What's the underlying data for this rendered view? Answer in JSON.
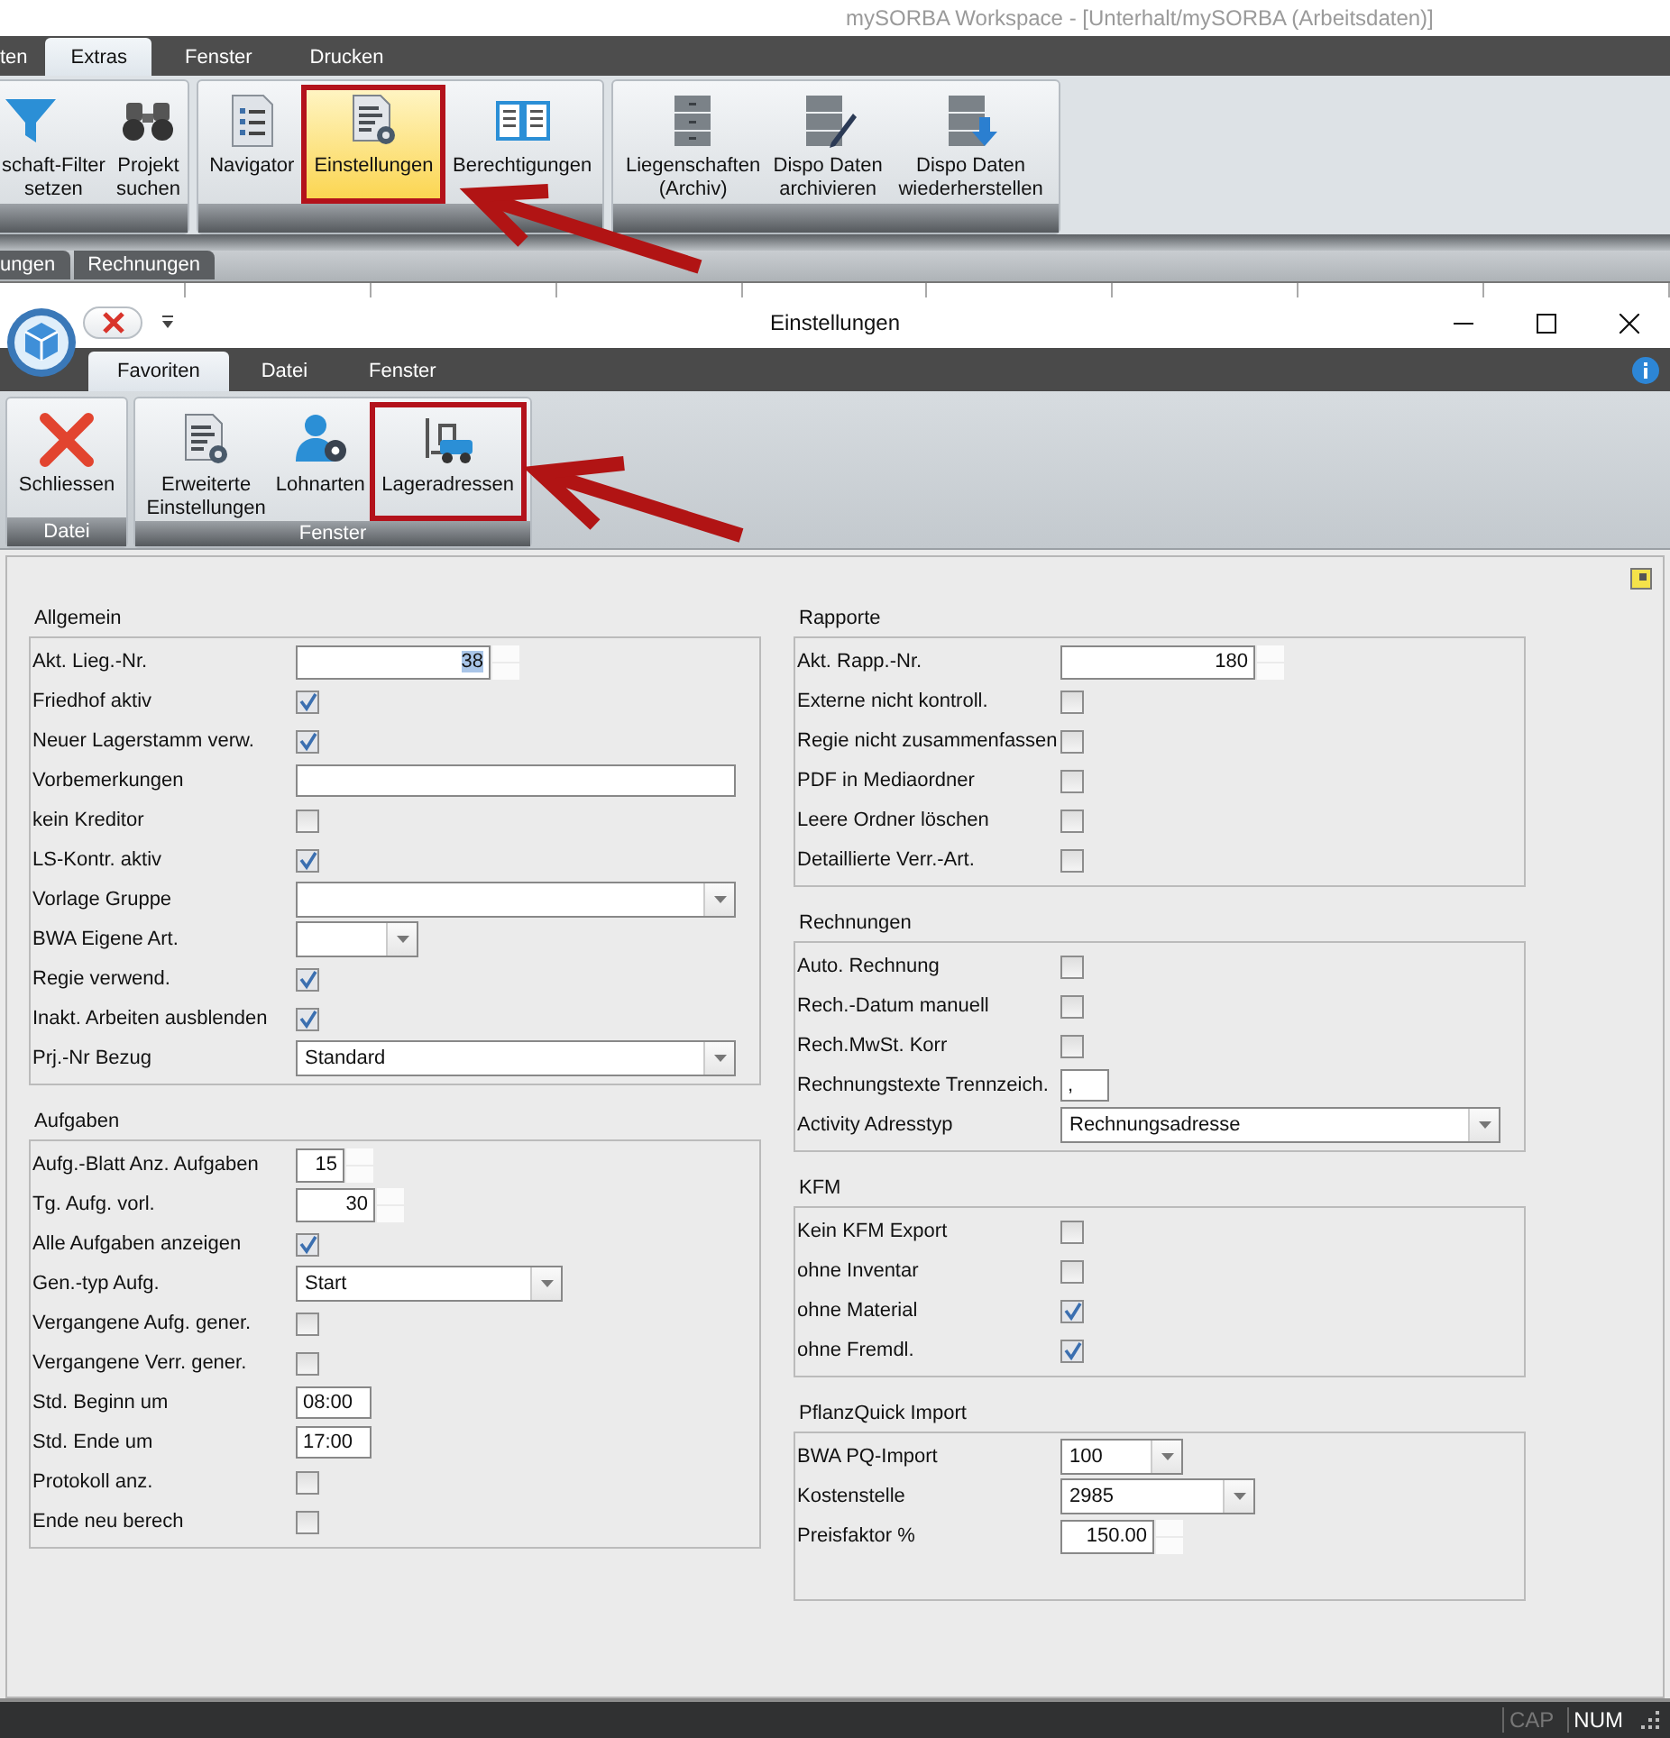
{
  "app": {
    "title": "mySORBA Workspace - [Unterhalt/mySORBA (Arbeitsdaten)]",
    "tabs": [
      {
        "label": "ten",
        "selected": false
      },
      {
        "label": "Extras",
        "selected": true
      },
      {
        "label": "Fenster",
        "selected": false
      },
      {
        "label": "Drucken",
        "selected": false
      }
    ],
    "ribbon_groups": [
      {
        "buttons": [
          {
            "label": "schaft-Filter\nsetzen",
            "selected": false,
            "highlighted": false
          },
          {
            "label": "Projekt\nsuchen",
            "selected": false,
            "highlighted": false
          }
        ]
      },
      {
        "buttons": [
          {
            "label": "Navigator",
            "selected": false,
            "highlighted": false
          },
          {
            "label": "Einstellungen",
            "selected": true,
            "highlighted": true
          },
          {
            "label": "Berechtigungen",
            "selected": false,
            "highlighted": false
          }
        ]
      },
      {
        "buttons": [
          {
            "label": "Liegenschaften\n(Archiv)",
            "selected": false,
            "highlighted": false
          },
          {
            "label": "Dispo Daten\narchivieren",
            "selected": false,
            "highlighted": false
          },
          {
            "label": "Dispo Daten\nwiederherstellen",
            "selected": false,
            "highlighted": false
          }
        ]
      }
    ],
    "document_tabs": [
      {
        "label": "ungen"
      },
      {
        "label": "Rechnungen"
      }
    ]
  },
  "dialog": {
    "title": "Einstellungen",
    "tabs": [
      {
        "label": "Favoriten",
        "selected": true
      },
      {
        "label": "Datei",
        "selected": false
      },
      {
        "label": "Fenster",
        "selected": false
      }
    ],
    "ribbon_groups": [
      {
        "label": "Datei",
        "buttons": [
          {
            "label": "Schliessen",
            "highlighted": false
          }
        ]
      },
      {
        "label": "Fenster",
        "buttons": [
          {
            "label": "Erweiterte\nEinstellungen",
            "highlighted": false
          },
          {
            "label": "Lohnarten",
            "highlighted": false
          },
          {
            "label": "Lageradressen",
            "highlighted": true
          }
        ]
      }
    ],
    "columns": [
      {
        "sections": [
          {
            "title": "Allgemein",
            "rows": [
              {
                "label": "Akt. Lieg.-Nr.",
                "kind": "spin",
                "value": "38",
                "text_selected": true
              },
              {
                "label": "Friedhof aktiv",
                "kind": "checkbox",
                "checked": true
              },
              {
                "label": "Neuer Lagerstamm verw.",
                "kind": "checkbox",
                "checked": true
              },
              {
                "label": "Vorbemerkungen",
                "kind": "text"
              },
              {
                "label": "kein Kreditor",
                "kind": "checkbox",
                "checked": false
              },
              {
                "label": "LS-Kontr. aktiv",
                "kind": "checkbox",
                "checked": true
              },
              {
                "label": "Vorlage Gruppe",
                "kind": "combo"
              },
              {
                "label": "BWA Eigene Art.",
                "kind": "combo"
              },
              {
                "label": "Regie verwend.",
                "kind": "checkbox",
                "checked": true
              },
              {
                "label": "Inakt. Arbeiten ausblenden",
                "kind": "checkbox",
                "checked": true
              },
              {
                "label": "Prj.-Nr Bezug",
                "kind": "combo",
                "value": "Standard"
              }
            ]
          },
          {
            "title": "Aufgaben",
            "rows": [
              {
                "label": "Aufg.-Blatt Anz. Aufgaben",
                "kind": "spin",
                "value": "15"
              },
              {
                "label": "Tg. Aufg. vorl.",
                "kind": "spin",
                "value": "30"
              },
              {
                "label": "Alle Aufgaben anzeigen",
                "kind": "checkbox",
                "checked": true
              },
              {
                "label": "Gen.-typ Aufg.",
                "kind": "combo",
                "value": "Start"
              },
              {
                "label": "Vergangene Aufg. gener.",
                "kind": "checkbox",
                "checked": false
              },
              {
                "label": "Vergangene Verr. gener.",
                "kind": "checkbox",
                "checked": false
              },
              {
                "label": "Std. Beginn um",
                "kind": "text",
                "value": "08:00"
              },
              {
                "label": "Std. Ende um",
                "kind": "text",
                "value": "17:00"
              },
              {
                "label": "Protokoll anz.",
                "kind": "checkbox",
                "checked": false
              },
              {
                "label": "Ende neu berech",
                "kind": "checkbox",
                "checked": false
              }
            ]
          }
        ]
      },
      {
        "sections": [
          {
            "title": "Rapporte",
            "rows": [
              {
                "label": "Akt. Rapp.-Nr.",
                "kind": "spin",
                "value": "180"
              },
              {
                "label": "Externe nicht kontroll.",
                "kind": "checkbox",
                "checked": false
              },
              {
                "label": "Regie nicht zusammenfassen",
                "kind": "checkbox",
                "checked": false
              },
              {
                "label": "PDF in Mediaordner",
                "kind": "checkbox",
                "checked": false
              },
              {
                "label": "Leere Ordner löschen",
                "kind": "checkbox",
                "checked": false
              },
              {
                "label": "Detaillierte Verr.-Art.",
                "kind": "checkbox",
                "checked": false
              }
            ]
          },
          {
            "title": "Rechnungen",
            "rows": [
              {
                "label": "Auto. Rechnung",
                "kind": "checkbox",
                "checked": false
              },
              {
                "label": "Rech.-Datum manuell",
                "kind": "checkbox",
                "checked": false
              },
              {
                "label": "Rech.MwSt. Korr",
                "kind": "checkbox",
                "checked": false
              },
              {
                "label": "Rechnungstexte Trennzeich.",
                "kind": "text",
                "value": ","
              },
              {
                "label": "Activity Adresstyp",
                "kind": "combo",
                "value": "Rechnungsadresse"
              }
            ]
          },
          {
            "title": "KFM",
            "rows": [
              {
                "label": "Kein KFM Export",
                "kind": "checkbox",
                "checked": false
              },
              {
                "label": "ohne Inventar",
                "kind": "checkbox",
                "checked": false
              },
              {
                "label": "ohne Material",
                "kind": "checkbox",
                "checked": true
              },
              {
                "label": "ohne Fremdl.",
                "kind": "checkbox",
                "checked": true
              }
            ]
          },
          {
            "title": "PflanzQuick Import",
            "rows": [
              {
                "label": "BWA PQ-Import",
                "kind": "combo",
                "value": "100"
              },
              {
                "label": "Kostenstelle",
                "kind": "combo",
                "value": "2985"
              },
              {
                "label": "Preisfaktor %",
                "kind": "spin",
                "value": "150.00"
              }
            ]
          }
        ]
      }
    ]
  },
  "status_bar": {
    "indicators": [
      {
        "label": "CAP",
        "on": false
      },
      {
        "label": "NUM",
        "on": true
      }
    ]
  }
}
